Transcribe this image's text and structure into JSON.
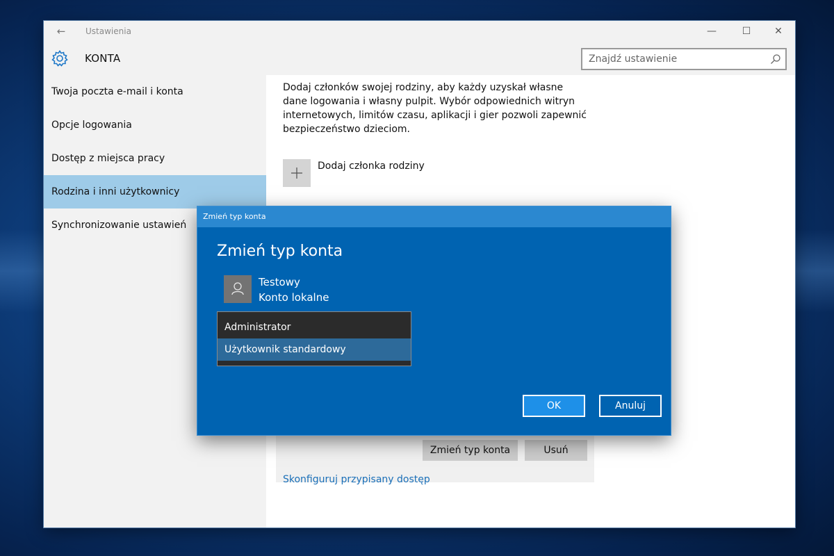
{
  "window": {
    "title": "Ustawienia",
    "controls": {
      "minimize": "—",
      "maximize": "☐",
      "close": "✕"
    }
  },
  "header": {
    "section_title": "KONTA",
    "search_placeholder": "Znajdź ustawienie"
  },
  "sidebar": {
    "items": [
      {
        "label": "Twoja poczta e-mail i konta",
        "active": false
      },
      {
        "label": "Opcje logowania",
        "active": false
      },
      {
        "label": "Dostęp z miejsca pracy",
        "active": false
      },
      {
        "label": "Rodzina i inni użytkownicy",
        "active": true
      },
      {
        "label": "Synchronizowanie ustawień",
        "active": false
      }
    ]
  },
  "content": {
    "intro": "Dodaj członków swojej rodziny, aby każdy uzyskał własne dane logowania i własny pulpit. Wybór odpowiednich witryn internetowych, limitów czasu, aplikacji i gier pozwoli zapewnić bezpieczeństwo dzieciom.",
    "add_family_label": "Dodaj członka rodziny",
    "change_type_button": "Zmień typ konta",
    "remove_button": "Usuń",
    "assigned_access_link": "Skonfiguruj przypisany dostęp"
  },
  "dialog": {
    "titlebar": "Zmień typ konta",
    "heading": "Zmień typ konta",
    "user_name": "Testowy",
    "user_type": "Konto lokalne",
    "options": [
      {
        "label": "Administrator",
        "selected": false
      },
      {
        "label": "Użytkownik standardowy",
        "selected": true
      }
    ],
    "ok_label": "OK",
    "cancel_label": "Anuluj"
  },
  "colors": {
    "accent": "#0063b1",
    "dialog_titlebar": "#2b88d0",
    "sidebar_active": "#9ecbe8",
    "link": "#1a6fb8"
  }
}
